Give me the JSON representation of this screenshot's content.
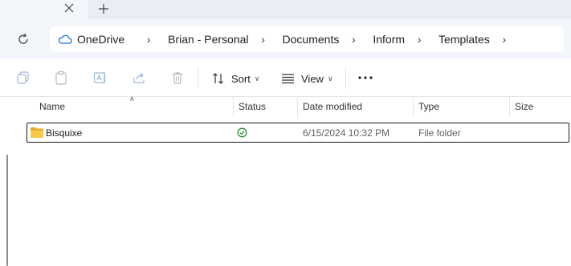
{
  "addressbar": {
    "breadcrumbs": [
      "OneDrive",
      "Brian - Personal",
      "Documents",
      "Inform",
      "Templates"
    ]
  },
  "toolbar": {
    "sort_label": "Sort",
    "view_label": "View"
  },
  "columns": {
    "name": "Name",
    "status": "Status",
    "date_modified": "Date modified",
    "type": "Type",
    "size": "Size"
  },
  "files": [
    {
      "name": "Bisquixe",
      "status_icon": "synced-check-icon",
      "date_modified": "6/15/2024 10:32 PM",
      "type": "File folder",
      "size": ""
    }
  ],
  "colors": {
    "folder": "#f2c14e",
    "status_ok": "#2e8b3e",
    "chrome_bg": "#f3f6fb"
  }
}
